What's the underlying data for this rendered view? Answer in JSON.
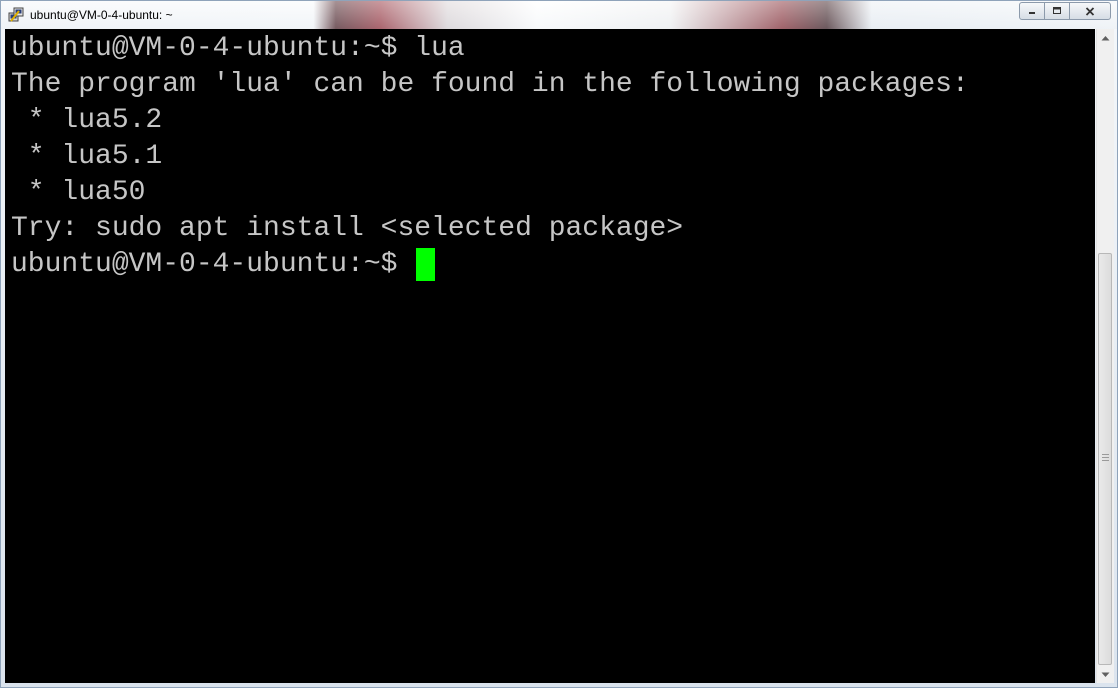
{
  "window": {
    "title": "ubuntu@VM-0-4-ubuntu: ~",
    "app_icon": "putty-icon",
    "controls": {
      "minimize": "minimize-icon",
      "maximize": "maximize-icon",
      "close": "close-icon"
    }
  },
  "terminal": {
    "lines": [
      "ubuntu@VM-0-4-ubuntu:~$ lua",
      "The program 'lua' can be found in the following packages:",
      " * lua5.2",
      " * lua5.1",
      " * lua50",
      "Try: sudo apt install <selected package>"
    ],
    "prompt": "ubuntu@VM-0-4-ubuntu:~$ ",
    "text_color": "#c6c6c6",
    "background_color": "#000000",
    "cursor_color": "#00ff00"
  },
  "scrollbar": {
    "up_arrow": "scroll-up-icon",
    "down_arrow": "scroll-down-icon"
  }
}
